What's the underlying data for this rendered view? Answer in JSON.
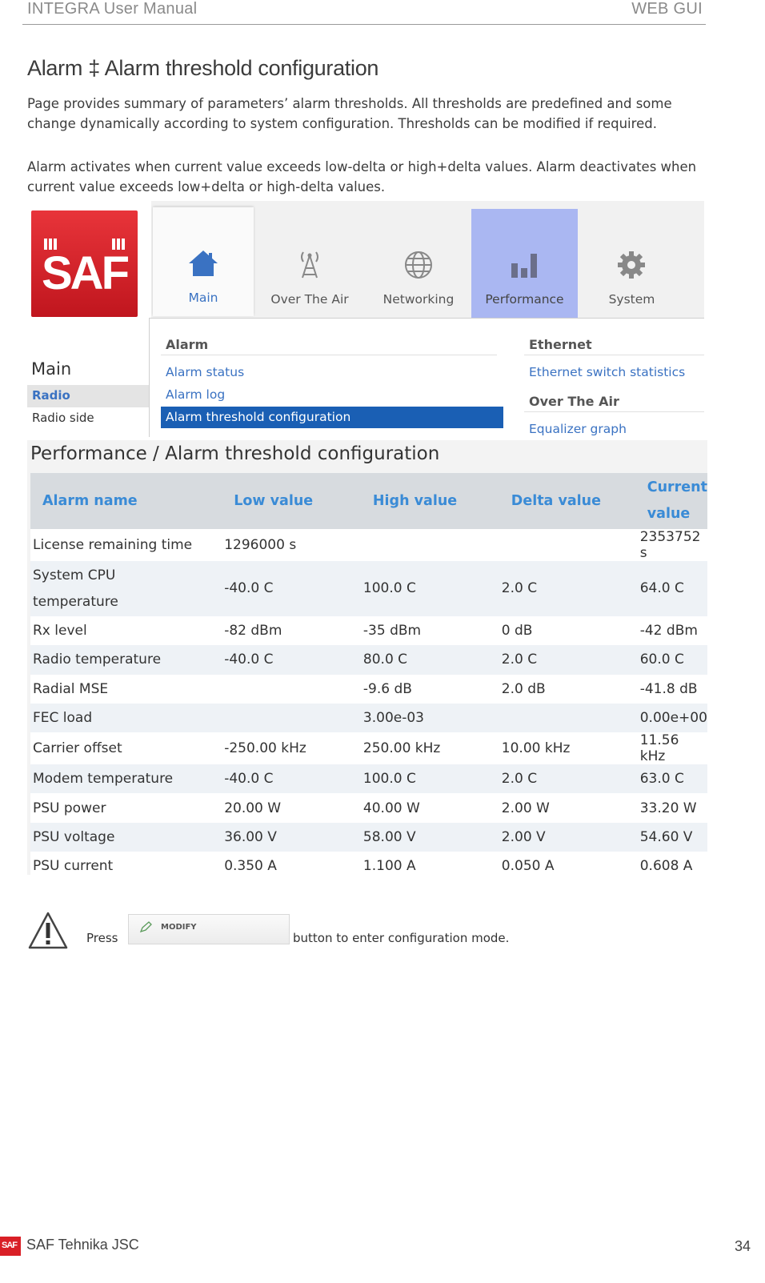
{
  "header": {
    "left": "INTEGRA User Manual",
    "right": "WEB GUI"
  },
  "section_title": "Alarm ‡   Alarm threshold configuration",
  "paragraphs": [
    "Page provides summary of parameters’ alarm thresholds. All thresholds are predefined and some change dynamically according to system configuration. Thresholds can be modified if required.",
    "Alarm activates when current value exceeds low-delta or high+delta values. Alarm deactivates when current value exceeds low+delta or high-delta values."
  ],
  "screenshot": {
    "logo_text": "SAF",
    "tabs": [
      {
        "label": "Main",
        "icon": "home-icon"
      },
      {
        "label": "Over The Air",
        "icon": "antenna-tower-icon"
      },
      {
        "label": "Networking",
        "icon": "globe-icon"
      },
      {
        "label": "Performance",
        "icon": "bar-chart-icon"
      },
      {
        "label": "System",
        "icon": "gear-icon"
      }
    ],
    "sidebar": {
      "title": "Main",
      "items": [
        "Radio",
        "Radio side"
      ]
    },
    "menu": {
      "col1_header": "Alarm",
      "col1_items": [
        "Alarm status",
        "Alarm log",
        "Alarm threshold configuration"
      ],
      "col2_header1": "Ethernet",
      "col2_item1": "Ethernet switch statistics",
      "col2_header2": "Over The Air",
      "col2_item2": "Equalizer graph"
    }
  },
  "page_title": "Performance / Alarm threshold configuration",
  "table": {
    "headers": [
      "Alarm name",
      "Low value",
      "High value",
      "Delta value",
      "Current value"
    ],
    "rows": [
      [
        "License remaining time",
        "1296000 s",
        "",
        "",
        "2353752 s"
      ],
      [
        "System CPU temperature",
        "-40.0 C",
        "100.0 C",
        "2.0 C",
        "64.0 C"
      ],
      [
        "Rx level",
        "-82 dBm",
        "-35 dBm",
        "0 dB",
        "-42 dBm"
      ],
      [
        "Radio temperature",
        "-40.0 C",
        "80.0 C",
        "2.0 C",
        "60.0 C"
      ],
      [
        "Radial MSE",
        "",
        "-9.6 dB",
        "2.0 dB",
        "-41.8 dB"
      ],
      [
        "FEC load",
        "",
        "3.00e-03",
        "",
        "0.00e+00"
      ],
      [
        "Carrier offset",
        "-250.00 kHz",
        "250.00 kHz",
        "10.00 kHz",
        "11.56 kHz"
      ],
      [
        "Modem temperature",
        "-40.0 C",
        "100.0 C",
        "2.0 C",
        "63.0 C"
      ],
      [
        "PSU power",
        "20.00 W",
        "40.00 W",
        "2.00 W",
        "33.20 W"
      ],
      [
        "PSU voltage",
        "36.00 V",
        "58.00 V",
        "2.00 V",
        "54.60 V"
      ],
      [
        "PSU current",
        "0.350 A",
        "1.100 A",
        "0.050 A",
        "0.608 A"
      ]
    ]
  },
  "note": {
    "press": "Press",
    "button_label": "MODIFY",
    "after": "button to enter configuration mode."
  },
  "footer": {
    "logo": "SAF",
    "company": "SAF Tehnika JSC",
    "page": "34"
  }
}
